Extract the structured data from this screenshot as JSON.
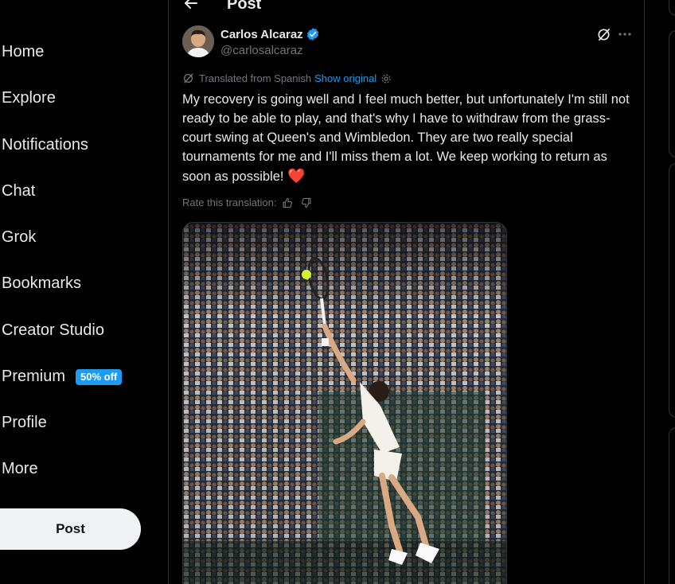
{
  "nav": {
    "items": [
      {
        "label": "Home"
      },
      {
        "label": "Explore"
      },
      {
        "label": "Notifications"
      },
      {
        "label": "Chat"
      },
      {
        "label": "Grok"
      },
      {
        "label": "Bookmarks"
      },
      {
        "label": "Creator Studio"
      },
      {
        "label": "Premium",
        "badge": "50% off"
      },
      {
        "label": "Profile"
      },
      {
        "label": "More"
      }
    ],
    "post_button": "Post"
  },
  "header": {
    "title": "Post"
  },
  "tweet": {
    "author_name": "Carlos Alcaraz",
    "handle": "@carlosalcaraz",
    "translated_label": "Translated from Spanish",
    "show_original": "Show original",
    "text": "My recovery is going well and I feel much better, but unfortunately I'm still not ready to be able to play, and that's why I have to withdraw from the grass-court swing at Queen's and Wimbledon. They are two really special tournaments for me and I'll miss them a lot. We keep working to return as soon as possible!",
    "emoji": "❤️",
    "rate_label": "Rate this translation:"
  },
  "colors": {
    "accent": "#1d9bf0",
    "background": "#000000",
    "text": "#e7e9ea",
    "muted": "#71767b",
    "heart": "#f91880"
  }
}
